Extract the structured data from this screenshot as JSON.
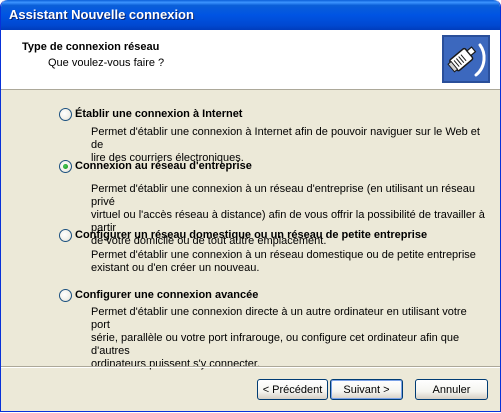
{
  "window": {
    "title": "Assistant Nouvelle connexion"
  },
  "header": {
    "title": "Type de connexion réseau",
    "subtitle": "Que voulez-vous faire ?",
    "icon": "network-cable-plug-icon"
  },
  "options": [
    {
      "label": "Établir une connexion à Internet",
      "selected": false,
      "description": [
        "Permet d'établir une connexion à Internet afin de pouvoir naviguer sur le Web et de",
        "lire des courriers électroniques."
      ]
    },
    {
      "label": "Connexion au réseau d'entreprise",
      "selected": true,
      "description": [
        "Permet d'établir une connexion à un réseau d'entreprise (en utilisant un réseau privé",
        "virtuel ou l'accès réseau à distance) afin de vous offrir la possibilité de travailler à partir",
        "de votre domicile ou de tout autre emplacement."
      ]
    },
    {
      "label": "Configurer un réseau domestique ou un réseau de petite entreprise",
      "selected": false,
      "description": [
        "Permet d'établir une connexion à un réseau domestique ou de petite entreprise",
        "existant ou d'en créer un nouveau."
      ]
    },
    {
      "label": "Configurer une connexion avancée",
      "selected": false,
      "description": [
        "Permet d'établir une connexion directe à un autre ordinateur en utilisant votre port",
        "série, parallèle ou votre port infrarouge, ou configure cet ordinateur afin que d'autres",
        "ordinateurs puissent s'y connecter."
      ]
    }
  ],
  "buttons": {
    "back": "< Précédent",
    "next": "Suivant >",
    "cancel": "Annuler"
  }
}
